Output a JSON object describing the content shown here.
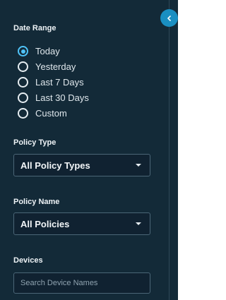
{
  "date_range": {
    "label": "Date Range",
    "options": [
      "Today",
      "Yesterday",
      "Last 7 Days",
      "Last 30 Days",
      "Custom"
    ],
    "selected": "Today"
  },
  "policy_type": {
    "label": "Policy Type",
    "value": "All Policy Types"
  },
  "policy_name": {
    "label": "Policy Name",
    "value": "All Policies"
  },
  "devices": {
    "label": "Devices",
    "placeholder": "Search Device Names"
  },
  "icons": {
    "collapse": "chevron-left-icon",
    "dropdown": "caret-down-icon"
  },
  "colors": {
    "panel_bg": "#132a38",
    "accent": "#1a8fc2",
    "selected_radio": "#4fc3f7"
  }
}
